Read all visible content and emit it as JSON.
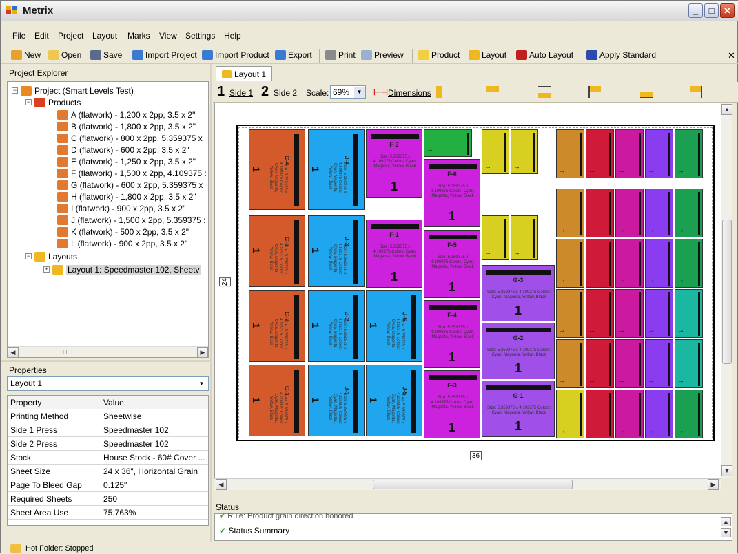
{
  "window": {
    "title": "Metrix",
    "minimize": "_",
    "maximize": "□",
    "close": "✕"
  },
  "menu": [
    "File",
    "Edit",
    "Project",
    "Layout",
    "Marks",
    "View",
    "Settings",
    "Help"
  ],
  "toolbar": {
    "new": "New",
    "open": "Open",
    "save": "Save",
    "import_project": "Import Project",
    "import_product": "Import Product",
    "export": "Export",
    "print": "Print",
    "preview": "Preview",
    "product": "Product",
    "layout": "Layout",
    "auto_layout": "Auto Layout",
    "apply_standard": "Apply Standard",
    "close": "✕"
  },
  "explorer": {
    "title": "Project Explorer",
    "project": "Project (Smart Levels Test)",
    "products_label": "Products",
    "products": [
      "A (flatwork) - 1,200 x 2pp, 3.5 x 2\"",
      "B (flatwork) - 1,800 x 2pp, 3.5 x 2\"",
      "C (flatwork) - 800 x 2pp, 5.359375 x",
      "D (flatwork) - 600 x 2pp, 3.5 x 2\"",
      "E (flatwork) - 1,250 x 2pp, 3.5 x 2\"",
      "F (flatwork) - 1,500 x 2pp, 4.109375 :",
      "G (flatwork) - 600 x 2pp, 5.359375 x",
      "H (flatwork) - 1,800 x 2pp, 3.5 x 2\"",
      "I (flatwork) - 900 x 2pp, 3.5 x 2\"",
      "J (flatwork) - 1,500 x 2pp, 5.359375 :",
      "K (flatwork) - 500 x 2pp, 3.5 x 2\"",
      "L (flatwork) - 900 x 2pp, 3.5 x 2\""
    ],
    "layouts_label": "Layouts",
    "layout_item": "Layout 1: Speedmaster 102, Sheetv",
    "scroll_thumb": "III"
  },
  "properties": {
    "title": "Properties",
    "selected": "Layout 1",
    "header_property": "Property",
    "header_value": "Value",
    "rows": [
      {
        "k": "Printing Method",
        "v": "Sheetwise"
      },
      {
        "k": "Side 1 Press",
        "v": "Speedmaster 102"
      },
      {
        "k": "Side 2 Press",
        "v": "Speedmaster 102"
      },
      {
        "k": "Stock",
        "v": "House Stock - 60# Cover ..."
      },
      {
        "k": "Sheet Size",
        "v": "24 x 36\", Horizontal Grain"
      },
      {
        "k": "Page To Bleed Gap",
        "v": "0.125\""
      },
      {
        "k": "Required Sheets",
        "v": "250"
      },
      {
        "k": "Sheet Area Use",
        "v": "75.763%"
      }
    ]
  },
  "layout_tab": "Layout 1",
  "layout_toolbar": {
    "side1_num": "1",
    "side1": "Side 1",
    "side2_num": "2",
    "side2": "Side 2",
    "scale_label": "Scale:",
    "scale_value": "69%",
    "dimensions": "Dimensions"
  },
  "sheet": {
    "width_label": "36",
    "height_label": "24",
    "pieces": [
      {
        "label": "C-4",
        "color": "#d45a2c",
        "qty": "1"
      },
      {
        "label": "C-3",
        "color": "#d45a2c",
        "qty": "1"
      },
      {
        "label": "C-2",
        "color": "#d45a2c",
        "qty": "1"
      },
      {
        "label": "C-1",
        "color": "#d45a2c",
        "qty": "1"
      },
      {
        "label": "J-4",
        "color": "#1fa6ef",
        "qty": "1"
      },
      {
        "label": "J-3",
        "color": "#1fa6ef",
        "qty": "1"
      },
      {
        "label": "J-2",
        "color": "#1fa6ef",
        "qty": "1"
      },
      {
        "label": "J-1",
        "color": "#1fa6ef",
        "qty": "1"
      },
      {
        "label": "J-6",
        "color": "#1fa6ef",
        "qty": "1"
      },
      {
        "label": "J-5",
        "color": "#1fa6ef",
        "qty": "1"
      },
      {
        "label": "F-2",
        "color": "#cc22dd",
        "qty": "1"
      },
      {
        "label": "F-1",
        "color": "#cc22dd",
        "qty": "1"
      },
      {
        "label": "F-6",
        "color": "#cc22dd",
        "qty": "1"
      },
      {
        "label": "F-5",
        "color": "#cc22dd",
        "qty": "1"
      },
      {
        "label": "F-4",
        "color": "#cc22dd",
        "qty": "1"
      },
      {
        "label": "F-3",
        "color": "#cc22dd",
        "qty": "1"
      },
      {
        "label": "G-3",
        "color": "#a050e8",
        "qty": "1"
      },
      {
        "label": "G-2",
        "color": "#a050e8",
        "qty": "1"
      },
      {
        "label": "G-1",
        "color": "#a050e8",
        "qty": "1"
      }
    ],
    "piece_text": "Size: 5.359375 x 4.109375 Colors: Cyan, Magenta, Yellow, Black",
    "small_colors": [
      "#cc8a2a",
      "#d01a3a",
      "#cc1aa0",
      "#8a3cf0",
      "#1aa050"
    ],
    "green_top": "#22b040",
    "yellow_small": "#d8d020",
    "teal_small": "#1ab8a0"
  },
  "status": {
    "title": "Status",
    "line1": "Rule: Product grain direction honored",
    "line2": "Status Summary"
  },
  "hot_folder": "Hot Folder: Stopped"
}
